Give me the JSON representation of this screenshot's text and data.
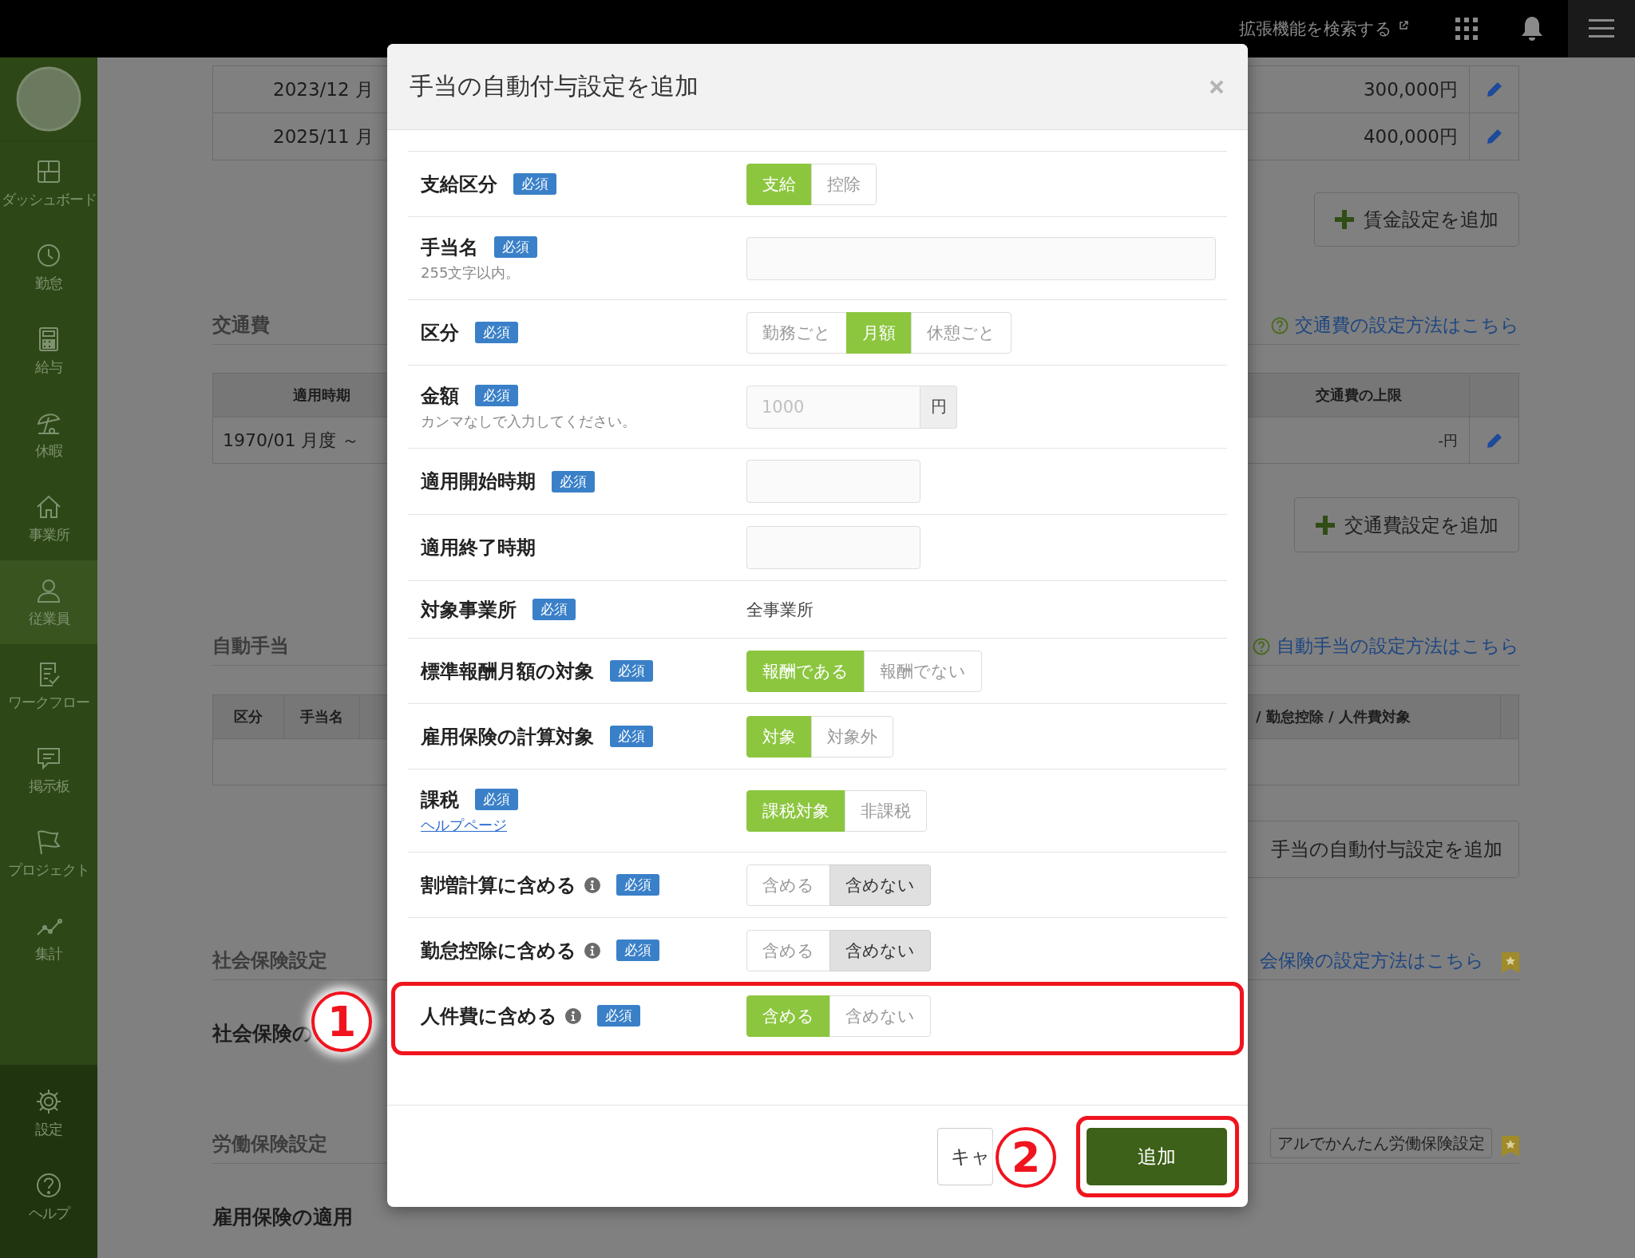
{
  "topbar": {
    "search_link": "拡張機能を検索する"
  },
  "sidebar": {
    "items": [
      {
        "label": "ダッシュボード",
        "selected": false
      },
      {
        "label": "勤怠",
        "selected": false
      },
      {
        "label": "給与",
        "selected": false
      },
      {
        "label": "休暇",
        "selected": false
      },
      {
        "label": "事業所",
        "selected": false
      },
      {
        "label": "従業員",
        "selected": true
      },
      {
        "label": "ワークフロー",
        "selected": false
      },
      {
        "label": "掲示板",
        "selected": false
      },
      {
        "label": "プロジェクト",
        "selected": false
      },
      {
        "label": "集計",
        "selected": false
      }
    ],
    "footer_items": [
      {
        "label": "設定",
        "selected": false
      },
      {
        "label": "ヘルプ",
        "selected": false
      }
    ]
  },
  "page": {
    "wage_table": {
      "rows": [
        {
          "period": "2023/12 月",
          "amount": "300,000円"
        },
        {
          "period": "2025/11 月",
          "amount": "400,000円"
        }
      ]
    },
    "wage_add_button": "賃金設定を追加",
    "commute": {
      "heading": "交通費",
      "help_link": "交通費の設定方法はこちら",
      "columns": [
        "適用時期",
        "交通費の上限"
      ],
      "rows": [
        {
          "period": "1970/01 月度 ～",
          "limit": "-円"
        }
      ],
      "add_button": "交通費設定を追加"
    },
    "allowance": {
      "heading": "自動手当",
      "help_link": "自動手当の設定方法はこちら",
      "columns": [
        "区分",
        "手当名",
        "/ 勤怠控除 / 人件費対象"
      ],
      "add_button": "手当の自動付与設定を追加"
    },
    "social": {
      "heading": "社会保険設定",
      "help_link": "会保険の設定方法はこちら",
      "field_label": "社会保険の"
    },
    "labor": {
      "heading": "労働保険設定",
      "manual_button": "アルでかんたん労働保険設定",
      "field_label": "雇用保険の適用"
    }
  },
  "modal": {
    "title": "手当の自動付与設定を追加",
    "rows": [
      {
        "label": "支給区分",
        "badge": "必須",
        "info": false,
        "kind": "segmented",
        "options": [
          {
            "label": "支給",
            "selected": true
          },
          {
            "label": "控除",
            "selected": false
          }
        ]
      },
      {
        "label": "手当名",
        "badge": "必須",
        "note": "255文字以内。",
        "info": false,
        "kind": "textbox"
      },
      {
        "label": "区分",
        "badge": "必須",
        "info": false,
        "kind": "segmented",
        "options": [
          {
            "label": "勤務ごと",
            "selected": false
          },
          {
            "label": "月額",
            "selected": true
          },
          {
            "label": "休憩ごと",
            "selected": false
          }
        ]
      },
      {
        "label": "金額",
        "badge": "必須",
        "note": "カンマなしで入力してください。",
        "info": false,
        "kind": "amount",
        "placeholder": "1000",
        "unit": "円"
      },
      {
        "label": "適用開始時期",
        "badge": "必須",
        "info": false,
        "kind": "datebox"
      },
      {
        "label": "適用終了時期",
        "info": false,
        "kind": "datebox"
      },
      {
        "label": "対象事業所",
        "badge": "必須",
        "info": false,
        "kind": "static",
        "value": "全事業所"
      },
      {
        "label": "標準報酬月額の対象",
        "badge": "必須",
        "info": false,
        "kind": "segmented",
        "options": [
          {
            "label": "報酬である",
            "selected": true
          },
          {
            "label": "報酬でない",
            "selected": false
          }
        ]
      },
      {
        "label": "雇用保険の計算対象",
        "badge": "必須",
        "info": false,
        "kind": "segmented",
        "options": [
          {
            "label": "対象",
            "selected": true
          },
          {
            "label": "対象外",
            "selected": false
          }
        ]
      },
      {
        "label": "課税",
        "badge": "必須",
        "help_link": "ヘルプページ",
        "info": false,
        "kind": "segmented",
        "options": [
          {
            "label": "課税対象",
            "selected": true
          },
          {
            "label": "非課税",
            "selected": false
          }
        ]
      },
      {
        "label": "割増計算に含める",
        "badge": "必須",
        "info": true,
        "kind": "toggle",
        "options": [
          {
            "label": "含める",
            "selected": false
          },
          {
            "label": "含めない",
            "selected": true
          }
        ]
      },
      {
        "label": "勤怠控除に含める",
        "badge": "必須",
        "info": true,
        "kind": "toggle",
        "options": [
          {
            "label": "含める",
            "selected": false
          },
          {
            "label": "含めない",
            "selected": true
          }
        ]
      },
      {
        "label": "人件費に含める",
        "badge": "必須",
        "info": true,
        "kind": "segmented",
        "options": [
          {
            "label": "含める",
            "selected": true
          },
          {
            "label": "含めない",
            "selected": false
          }
        ]
      }
    ],
    "cancel_button": "キャ",
    "submit_button": "追加"
  },
  "annotations": [
    {
      "kind": "frame"
    },
    {
      "kind": "number",
      "text": "1"
    },
    {
      "kind": "frame"
    },
    {
      "kind": "number",
      "text": "2"
    }
  ]
}
